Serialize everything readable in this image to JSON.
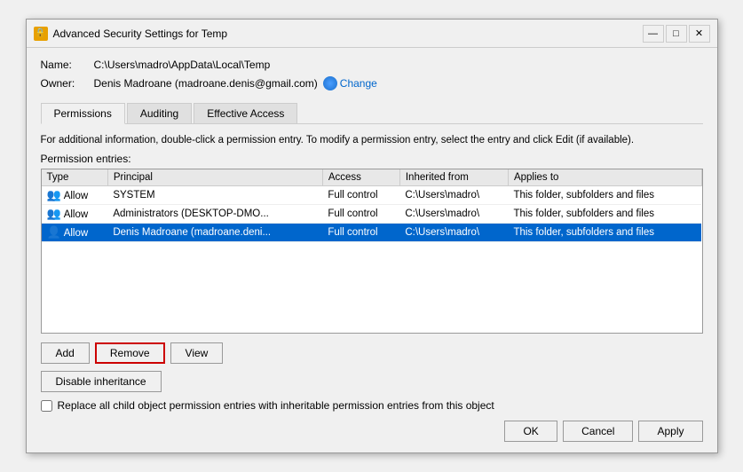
{
  "window": {
    "title": "Advanced Security Settings for Temp",
    "icon": "🔒"
  },
  "titlebar": {
    "minimize": "—",
    "maximize": "□",
    "close": "✕"
  },
  "fields": {
    "name_label": "Name:",
    "name_value": "C:\\Users\\madro\\AppData\\Local\\Temp",
    "owner_label": "Owner:",
    "owner_value": "Denis Madroane (madroane.denis@gmail.com)",
    "change_label": "Change"
  },
  "tabs": [
    {
      "label": "Permissions",
      "active": true
    },
    {
      "label": "Auditing",
      "active": false
    },
    {
      "label": "Effective Access",
      "active": false
    }
  ],
  "info_text": "For additional information, double-click a permission entry. To modify a permission entry, select the entry and click Edit (if available).",
  "section_label": "Permission entries:",
  "table": {
    "headers": [
      "Type",
      "Principal",
      "Access",
      "Inherited from",
      "Applies to"
    ],
    "rows": [
      {
        "type": "Allow",
        "principal": "SYSTEM",
        "access": "Full control",
        "inherited": "C:\\Users\\madro\\",
        "applies": "This folder, subfolders and files",
        "selected": false
      },
      {
        "type": "Allow",
        "principal": "Administrators (DESKTOP-DMO...",
        "access": "Full control",
        "inherited": "C:\\Users\\madro\\",
        "applies": "This folder, subfolders and files",
        "selected": false
      },
      {
        "type": "Allow",
        "principal": "Denis Madroane (madroane.deni...",
        "access": "Full control",
        "inherited": "C:\\Users\\madro\\",
        "applies": "This folder, subfolders and files",
        "selected": true
      }
    ]
  },
  "buttons": {
    "add": "Add",
    "remove": "Remove",
    "view": "View",
    "disable_inheritance": "Disable inheritance"
  },
  "checkbox": {
    "label": "Replace all child object permission entries with inheritable permission entries from this object"
  },
  "footer": {
    "ok": "OK",
    "cancel": "Cancel",
    "apply": "Apply"
  }
}
